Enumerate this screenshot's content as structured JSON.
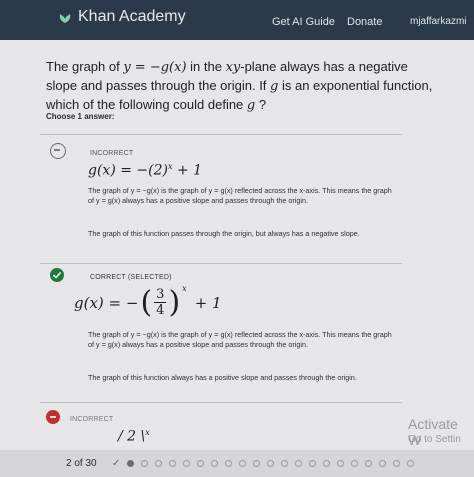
{
  "header": {
    "brand": "Khan Academy",
    "nav_get_ai": "Get AI Guide",
    "nav_donate": "Donate",
    "user": "mjaffarkazmi"
  },
  "question": {
    "text_1": "The graph of ",
    "math_1": "y = −g(x)",
    "text_2": " in the ",
    "math_2": "xy",
    "text_3": "-plane always has a negative slope and passes through the origin. If ",
    "math_3": "g",
    "text_4": " is an exponential function, which of the following could define ",
    "math_4": "g",
    "text_5": " ?"
  },
  "choose_label": "Choose 1 answer:",
  "choices": [
    {
      "status": "INCORRECT",
      "formula": "g(x) = −(2)",
      "exp": "x",
      "tail": " + 1",
      "expl_1": "The graph of y = −g(x) is the graph of y = g(x) reflected across the x-axis. This means the graph of y = g(x) always has a positive slope and passes through the origin.",
      "expl_2": "The graph of this function passes through the origin, but always has a negative slope."
    },
    {
      "status": "CORRECT (SELECTED)",
      "formula_lhs": "g(x) = −",
      "num": "3",
      "den": "4",
      "exp": "x",
      "tail": "+ 1",
      "expl_1": "The graph of y = −g(x) is the graph of y = g(x) reflected across the x-axis. This means the graph of y = g(x) always has a positive slope and passes through the origin.",
      "expl_2": "The graph of this function always has a positive slope and passes through the origin."
    },
    {
      "status": "INCORRECT",
      "formula": "/ 2 \\",
      "exp": "x"
    }
  ],
  "watermark": {
    "line1": "Activate W",
    "line2": "Go to Settin"
  },
  "footer": {
    "pager": "2 of 30"
  }
}
